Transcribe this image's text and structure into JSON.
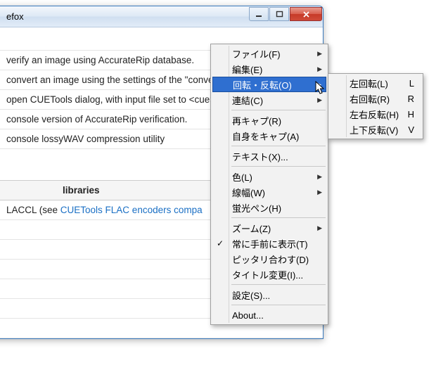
{
  "window": {
    "title_fragment": "efox"
  },
  "rows": [
    "verify an image using AccurateRip database.",
    "convert an image using the settings of the \"convert\" profile.",
    "open CUETools dialog, with input file set to <cue>.",
    "console version of AccurateRip verification.",
    "console lossyWAV compression utility"
  ],
  "section_header": "libraries",
  "lib_row_prefix": "LACCL (see ",
  "lib_row_link": "CUETools FLAC encoders compa",
  "menu": {
    "file": "ファイル(F)",
    "edit": "編集(E)",
    "rotate": "回転・反転(O)",
    "concat": "連結(C)",
    "recapture": "再キャプ(R)",
    "capture_self": "自身をキャプ(A)",
    "text": "テキスト(X)...",
    "color": "色(L)",
    "line_width": "線幅(W)",
    "highlighter": "蛍光ペン(H)",
    "zoom": "ズーム(Z)",
    "always_on_top": "常に手前に表示(T)",
    "fit": "ピッタリ合わす(D)",
    "title_change": "タイトル変更(I)...",
    "settings": "設定(S)...",
    "about": "About..."
  },
  "submenu": {
    "rotate_left": {
      "label": "左回転(L)",
      "accel": "L"
    },
    "rotate_right": {
      "label": "右回転(R)",
      "accel": "R"
    },
    "flip_h": {
      "label": "左右反転(H)",
      "accel": "H"
    },
    "flip_v": {
      "label": "上下反転(V)",
      "accel": "V"
    }
  }
}
